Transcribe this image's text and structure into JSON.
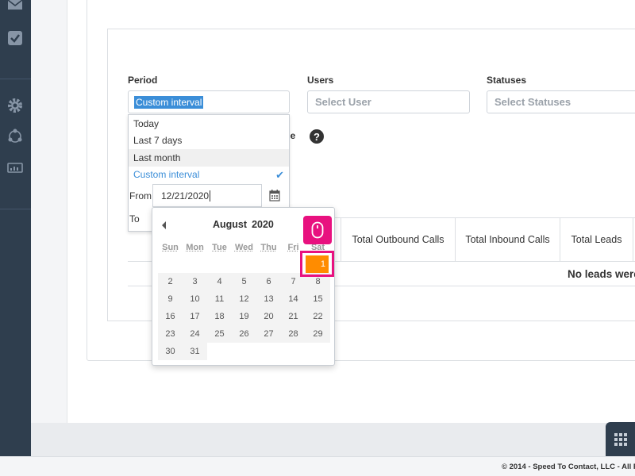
{
  "sidebar": {
    "icons": [
      "mail-icon",
      "check-square-icon",
      "gear-icon",
      "share-nodes-icon",
      "monitor-chart-icon"
    ]
  },
  "filters": {
    "period_label": "Period",
    "period_value": "Custom interval",
    "users_label": "Users",
    "users_placeholder": "Select User",
    "statuses_label": "Statuses",
    "statuses_placeholder": "Select Statuses",
    "hidden_label_fragment": "me",
    "help_icon": "?"
  },
  "period_dropdown": {
    "options": [
      {
        "label": "Today"
      },
      {
        "label": "Last 7 days"
      },
      {
        "label": "Last month"
      },
      {
        "label": "Custom interval"
      }
    ],
    "selected": "Custom interval",
    "from_label": "From",
    "from_value": "12/21/2020",
    "to_label": "To"
  },
  "calendar": {
    "month": "August",
    "year": "2020",
    "weekdays": [
      "Sun",
      "Mon",
      "Tue",
      "Wed",
      "Thu",
      "Fri",
      "Sat"
    ],
    "first_day": "1",
    "weeks": [
      [
        "2",
        "3",
        "4",
        "5",
        "6",
        "7",
        "8"
      ],
      [
        "9",
        "10",
        "11",
        "12",
        "13",
        "14",
        "15"
      ],
      [
        "16",
        "17",
        "18",
        "19",
        "20",
        "21",
        "22"
      ],
      [
        "23",
        "24",
        "25",
        "26",
        "27",
        "28",
        "29"
      ],
      [
        "30",
        "31"
      ]
    ],
    "highlight_color": "#ff8c00"
  },
  "table": {
    "headers": [
      "Total Outbound Calls",
      "Total Inbound Calls",
      "Total Leads"
    ],
    "empty_message": "No leads were"
  },
  "footer": {
    "text": "© 2014 - Speed To Contact, LLC - All Ri"
  },
  "colors": {
    "sidebar": "#2f3e4e",
    "accent": "#3b8ed8",
    "annotation": "#e8117f"
  }
}
